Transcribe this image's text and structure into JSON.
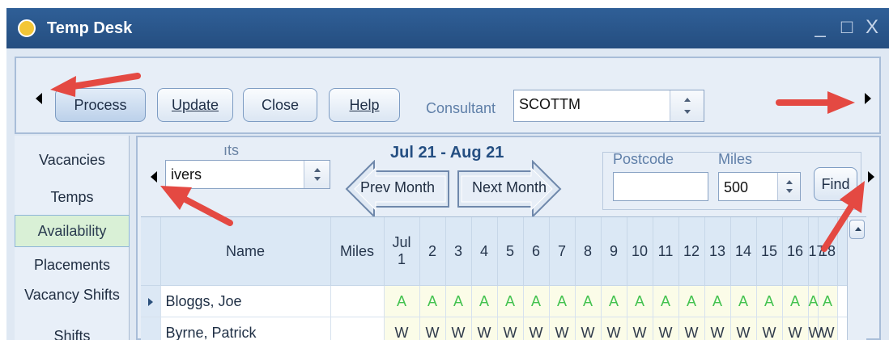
{
  "window": {
    "title": "Temp Desk",
    "controls": [
      "_",
      "□",
      "X"
    ]
  },
  "toolbar": {
    "buttons": {
      "process": "Process",
      "update": "Update",
      "close": "Close",
      "help": "Help"
    },
    "consultant_label": "Consultant",
    "consultant_value": "SCOTTM"
  },
  "sidebar": {
    "items": [
      "Vacancies",
      "Temps",
      "Availability",
      "Placements",
      "Vacancy Shifts",
      "Shifts"
    ],
    "active": "Availability"
  },
  "availability": {
    "filter_label_partial": "ıts",
    "filter_value": "ivers",
    "month_range": "Jul 21 - Aug 21",
    "prev_month": "Prev Month",
    "next_month": "Next Month",
    "postcode_label": "Postcode",
    "postcode_value": "",
    "miles_label": "Miles",
    "miles_value": "500",
    "find_label": "Find"
  },
  "grid": {
    "headers": {
      "name": "Name",
      "miles": "Miles",
      "month": "Jul"
    },
    "days": [
      "1",
      "2",
      "3",
      "4",
      "5",
      "6",
      "7",
      "8",
      "9",
      "10",
      "11",
      "12",
      "13",
      "14",
      "15",
      "16",
      "17",
      "18"
    ],
    "rows": [
      {
        "name": "Bloggs, Joe",
        "miles": "",
        "availability": [
          "A",
          "A",
          "A",
          "A",
          "A",
          "A",
          "A",
          "A",
          "A",
          "A",
          "A",
          "A",
          "A",
          "A",
          "A",
          "A",
          "A",
          "A"
        ]
      },
      {
        "name": "Byrne, Patrick",
        "miles": "",
        "availability": [
          "W",
          "W",
          "W",
          "W",
          "W",
          "W",
          "W",
          "W",
          "W",
          "W",
          "W",
          "W",
          "W",
          "W",
          "W",
          "W",
          "W",
          "W"
        ]
      }
    ]
  },
  "colors": {
    "titlebar": "#2f5f97",
    "available": "#43c24f",
    "highlight_arrow": "#e44942"
  }
}
